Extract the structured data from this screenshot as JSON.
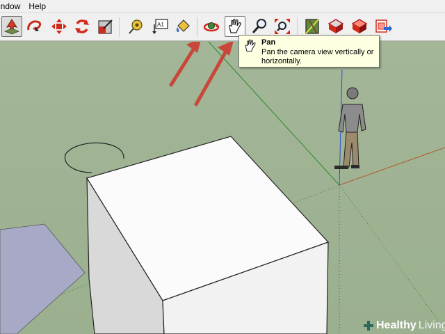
{
  "menu": {
    "items": [
      "indow",
      "Help"
    ]
  },
  "toolbar": {
    "tools": [
      {
        "name": "select-tool",
        "icon": "select-arrow-icon"
      },
      {
        "name": "lasso-tool",
        "icon": "lasso-icon"
      },
      {
        "name": "move-tool",
        "icon": "move-arrows-icon"
      },
      {
        "name": "rotate-tool",
        "icon": "rotate-icon"
      },
      {
        "name": "scale-tool",
        "icon": "scale-icon"
      },
      {
        "name": "tape-measure-tool",
        "icon": "tape-measure-icon"
      },
      {
        "name": "text-tool",
        "icon": "text-tag-icon",
        "label": "A1"
      },
      {
        "name": "paint-bucket-tool",
        "icon": "paint-bucket-icon"
      },
      {
        "name": "orbit-tool",
        "icon": "orbit-icon"
      },
      {
        "name": "pan-tool",
        "icon": "pan-hand-icon",
        "state": "hover"
      },
      {
        "name": "zoom-tool",
        "icon": "zoom-icon"
      },
      {
        "name": "zoom-extents-tool",
        "icon": "zoom-extents-icon"
      },
      {
        "name": "previous-view-tool",
        "icon": "previous-view-icon"
      },
      {
        "name": "get-models-tool",
        "icon": "get-models-icon"
      },
      {
        "name": "share-model-tool",
        "icon": "share-model-icon"
      },
      {
        "name": "warehouse-tool",
        "icon": "warehouse-icon"
      }
    ]
  },
  "tooltip": {
    "title": "Pan",
    "description": "Pan the camera view vertically or horizontally."
  },
  "watermark": {
    "brand": "Healthy",
    "brand_suffix": "Living"
  },
  "colors": {
    "ground": "#9fb394",
    "sky": "#9fb394",
    "box_top": "#fbfbfb",
    "box_side": "#d6d6d6",
    "annotation_arrow": "#c8463a",
    "polygon": "#a7a9c6",
    "axis_red": "#b05a2a",
    "axis_green": "#2b8a2b",
    "axis_blue": "#2a4fd0"
  }
}
